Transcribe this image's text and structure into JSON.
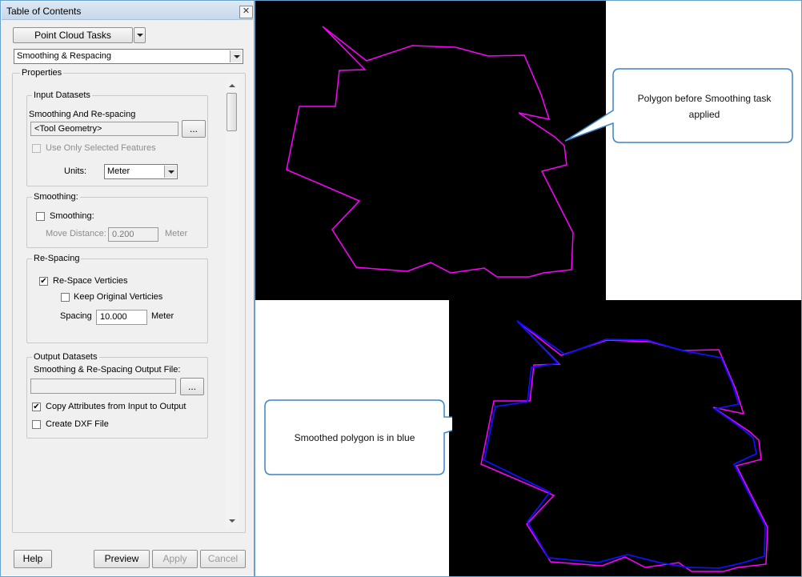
{
  "panel": {
    "title": "Table of Contents",
    "close_glyph": "✕",
    "task_dropdown": "Point Cloud Tasks",
    "task_select": "Smoothing & Respacing",
    "properties_label": "Properties",
    "input": {
      "group_title": "Input Datasets",
      "field_label": "Smoothing And Re-spacing",
      "geometry_value": "<Tool Geometry>",
      "browse": "...",
      "use_selected": "Use Only Selected Features",
      "units_label": "Units:",
      "units_value": "Meter"
    },
    "smoothing": {
      "group_title": "Smoothing:",
      "checkbox": "Smoothing:",
      "move_label": "Move Distance:",
      "move_value": "0.200",
      "move_unit": "Meter"
    },
    "respacing": {
      "group_title": "Re-Spacing",
      "respace": "Re-Space Verticies",
      "respace_checked": "✔",
      "keep": "Keep Original Verticies",
      "spacing_label": "Spacing",
      "spacing_value": "10.000",
      "spacing_unit": "Meter"
    },
    "output": {
      "group_title": "Output Datasets",
      "file_label": "Smoothing & Re-Spacing Output File:",
      "browse": "...",
      "copy_attrs": "Copy Attributes from Input to Output",
      "copy_checked": "✔",
      "dxf": "Create DXF File"
    },
    "buttons": {
      "help": "Help",
      "preview": "Preview",
      "apply": "Apply",
      "cancel": "Cancel"
    }
  },
  "callouts": {
    "top": "Polygon before Smoothing task applied",
    "bottom": "Smoothed polygon is in blue"
  },
  "colors": {
    "original_polygon": "#ff00ff",
    "smoothed_polygon": "#0000ff",
    "callout_border": "#3c84c4"
  }
}
